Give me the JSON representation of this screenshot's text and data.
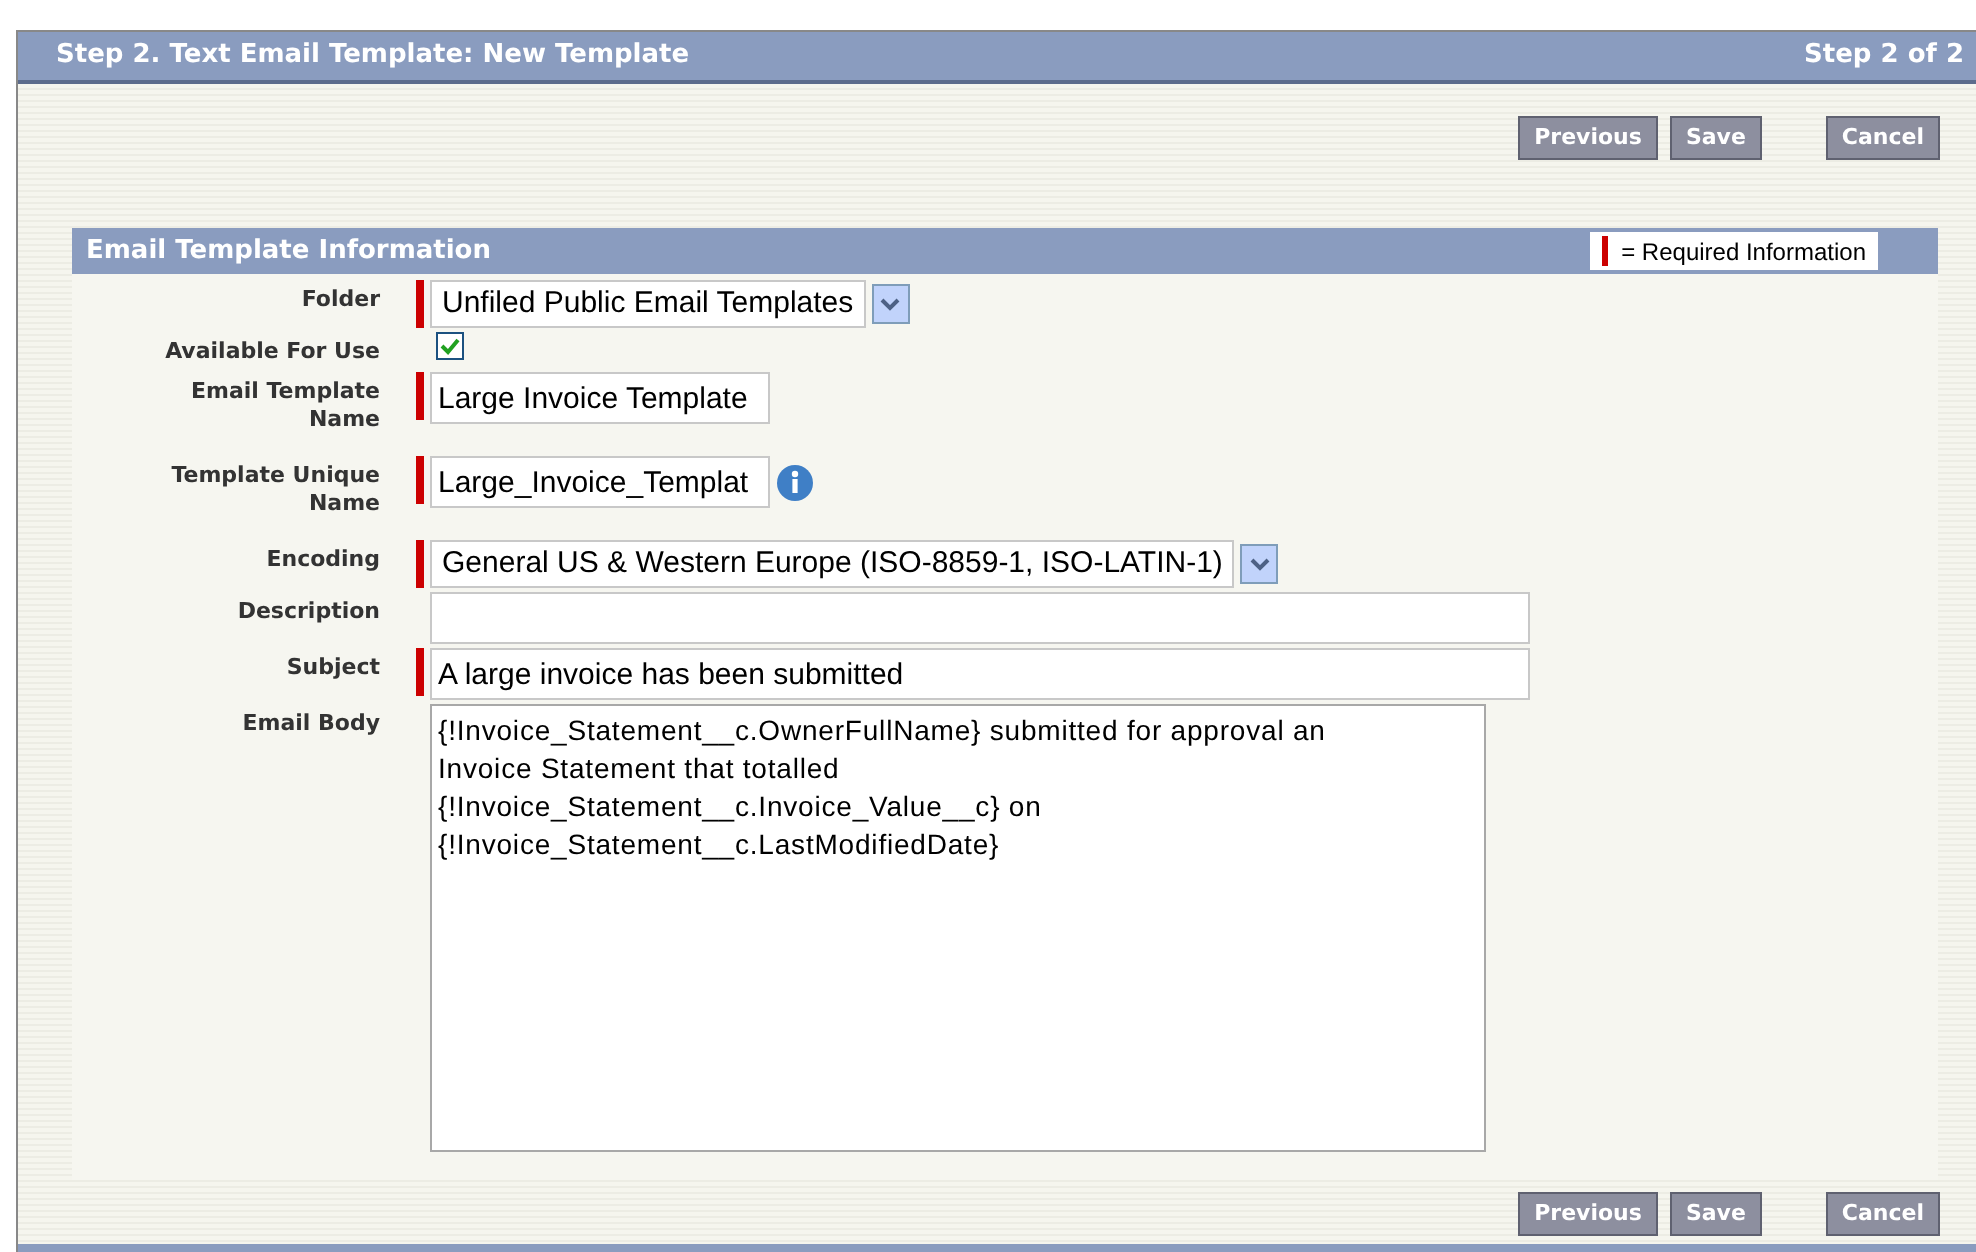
{
  "header": {
    "title": "Step 2. Text Email Template: New Template",
    "step": "Step 2 of 2"
  },
  "top_buttons": [
    "Previous",
    "Save",
    "Cancel"
  ],
  "bottom_buttons": [
    "Previous",
    "Save",
    "Cancel"
  ],
  "section": {
    "title": "Email Template Information",
    "legend": "= Required Information"
  },
  "fields": [
    {
      "kind": "select",
      "label": "Folder",
      "required": true,
      "value": "Unfiled Public Email Templates"
    },
    {
      "kind": "checkbox",
      "label": "Available For Use",
      "required": false,
      "checked": true
    },
    {
      "kind": "shorttext",
      "label": "Email Template Name",
      "required": true,
      "value": "Large Invoice Template",
      "info": false
    },
    {
      "kind": "shorttext",
      "label": "Template Unique Name",
      "required": true,
      "value": "Large_Invoice_Templat",
      "info": true
    },
    {
      "kind": "select",
      "label": "Encoding",
      "required": true,
      "value": "General US & Western Europe (ISO-8859-1, ISO-LATIN-1)"
    },
    {
      "kind": "longtext",
      "label": "Description",
      "required": false
    },
    {
      "kind": "longtext",
      "label": "Subject",
      "required": true,
      "value": "A large invoice has been submitted"
    },
    {
      "kind": "textarea",
      "label": "Email Body",
      "required": false,
      "value": "{!Invoice_Statement__c.OwnerFullName} submitted for approval an\nInvoice Statement that totalled\n{!Invoice_Statement__c.Invoice_Value__c} on\n{!Invoice_Statement__c.LastModifiedDate}"
    }
  ]
}
